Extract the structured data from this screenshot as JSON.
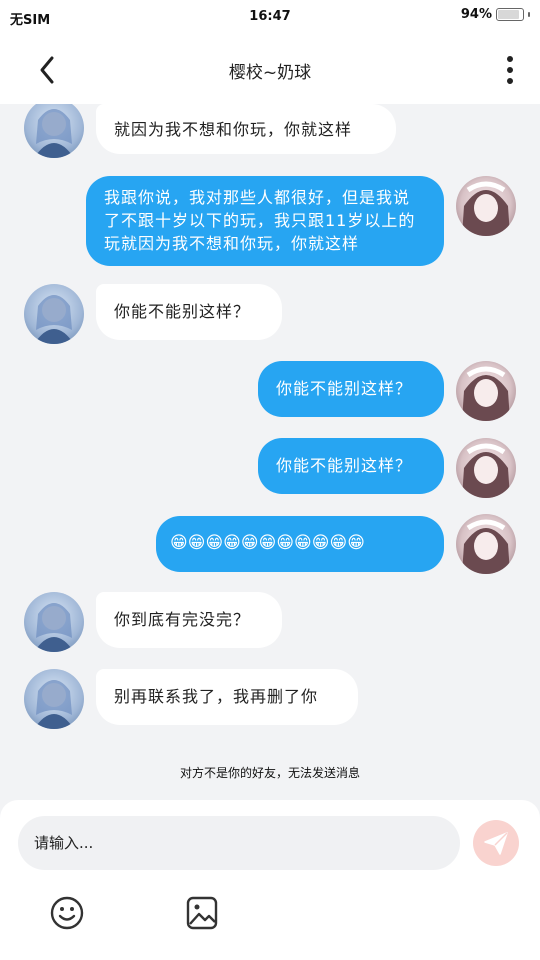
{
  "status_bar": {
    "carrier": "无SIM",
    "time": "16:47",
    "battery_text": "94%",
    "battery_level": 0.94
  },
  "header": {
    "title": "樱校~奶球",
    "back_icon": "chevron-left-icon",
    "more_icon": "more-vertical-icon"
  },
  "messages": [
    {
      "side": "in",
      "text": "就因为我不想和你玩，你就这样"
    },
    {
      "side": "out",
      "text": "我跟你说，我对那些人都很好，但是我说了不跟十岁以下的玩，我只跟11岁以上的玩就因为我不想和你玩，你就这样"
    },
    {
      "side": "in",
      "text": "你能不能别这样？"
    },
    {
      "side": "out",
      "text": "你能不能别这样？"
    },
    {
      "side": "out",
      "text": "你能不能别这样？"
    },
    {
      "side": "out",
      "text": "😁😁😁😁😁😁😁😁😁😁😁"
    },
    {
      "side": "in",
      "text": "你到底有完没完？"
    },
    {
      "side": "in",
      "text": "别再联系我了，我再删了你"
    }
  ],
  "notice": "对方不是你的好友，无法发送消息",
  "input": {
    "placeholder": "请输入...",
    "send_icon": "send-icon",
    "emoji_icon": "emoji-icon",
    "image_icon": "image-icon"
  },
  "colors": {
    "outgoing_bubble": "#27a5f2",
    "incoming_bubble": "#ffffff",
    "background": "#f2f3f5",
    "send_button": "#f9d3cf"
  }
}
